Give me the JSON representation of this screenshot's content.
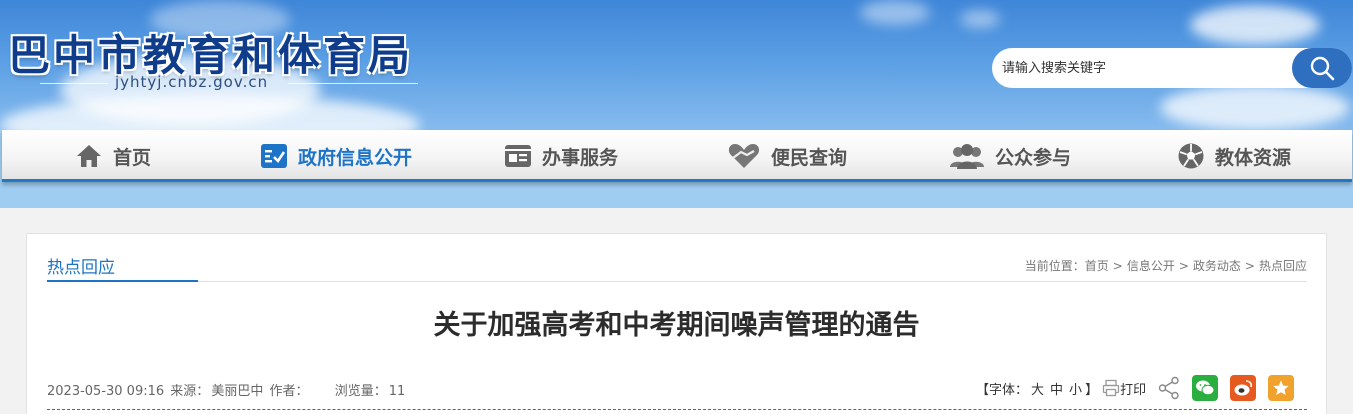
{
  "header": {
    "site_title": "巴中市教育和体育局",
    "site_url": "jyhtyj.cnbz.gov.cn",
    "search": {
      "placeholder": "请输入搜索关键字",
      "value": ""
    }
  },
  "nav": {
    "items": [
      {
        "label": "首页",
        "icon": "home-icon",
        "active": false
      },
      {
        "label": "政府信息公开",
        "icon": "checklist-icon",
        "active": true
      },
      {
        "label": "办事服务",
        "icon": "id-card-icon",
        "active": false
      },
      {
        "label": "便民查询",
        "icon": "heart-hand-icon",
        "active": false
      },
      {
        "label": "公众参与",
        "icon": "people-icon",
        "active": false
      },
      {
        "label": "教体资源",
        "icon": "football-icon",
        "active": false
      }
    ],
    "active_color": "#1d74c6"
  },
  "section": {
    "title": "热点回应"
  },
  "breadcrumb": {
    "prefix": "当前位置：",
    "items": [
      "首页",
      "信息公开",
      "政务动态",
      "热点回应"
    ],
    "separator": ">"
  },
  "article": {
    "title": "关于加强高考和中考期间噪声管理的通告",
    "date": "2023-05-30 09:16",
    "source_label": "来源：",
    "source": "美丽巴中",
    "author_label": "作者：",
    "views_label": "浏览量：",
    "views": "11"
  },
  "tools": {
    "font_label_open": "【字体：",
    "sizes": [
      "大",
      "中",
      "小"
    ],
    "font_label_close": "】",
    "print_label": "打印",
    "share_icons": [
      "share-icon",
      "wechat-icon",
      "weibo-icon",
      "favorite-star-icon"
    ]
  },
  "colors": {
    "brand_blue": "#1d74c6",
    "wechat": "#2aae40",
    "weibo": "#e65a1f",
    "star": "#f0a22c"
  }
}
